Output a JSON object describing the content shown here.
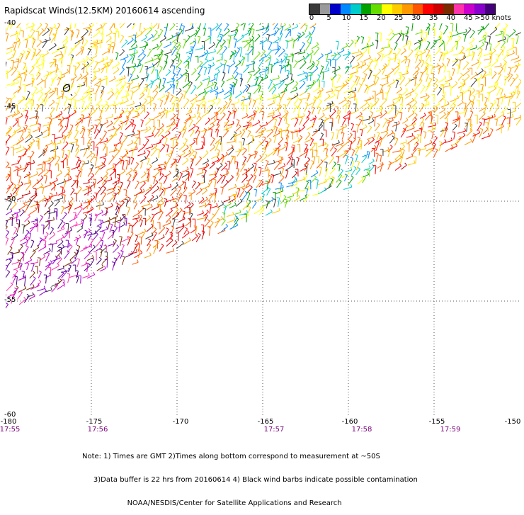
{
  "title": "Rapidscat Winds(12.5KM) 20160614 ascending",
  "colorbar": {
    "colors": [
      "#3a3a3a",
      "#9a9a9a",
      "#0000c8",
      "#0088ff",
      "#00cccc",
      "#00a000",
      "#66dd00",
      "#ffff00",
      "#ffcc00",
      "#ff9900",
      "#ff5500",
      "#ff0000",
      "#cc0000",
      "#7a2a00",
      "#ff33aa",
      "#cc00cc",
      "#8800cc",
      "#44007a"
    ],
    "ticks": [
      "0",
      "5",
      "10",
      "15",
      "20",
      "25",
      "30",
      "35",
      "40",
      "45",
      ">50 knots"
    ]
  },
  "map": {
    "lon_labels": [
      "-180",
      "-175",
      "-170",
      "-165",
      "-160",
      "-155",
      "-150"
    ],
    "lat_labels": [
      "-40",
      "-45",
      "-50",
      "-55",
      "-60"
    ],
    "time_labels": [
      "17:55",
      "17:56",
      "17:57",
      "17:58",
      "17:59"
    ]
  },
  "notes": [
    "Note: 1) Times are GMT 2)Times along bottom correspond to measurement at ~50S",
    "     3)Data buffer is 22 hrs from 20160614 4) Black wind barbs indicate possible contamination",
    "                    NOAA/NESDIS/Center for Satellite Applications and Research"
  ]
}
